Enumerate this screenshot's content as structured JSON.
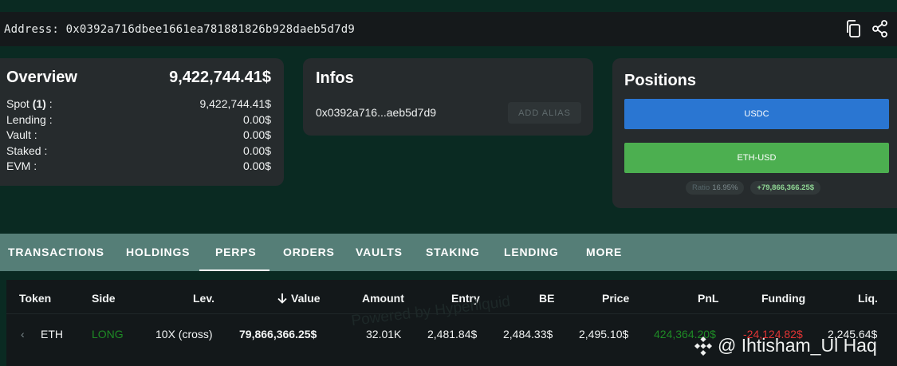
{
  "address_bar": {
    "text": "Address: 0x0392a716dbee1661ea781881826b928daeb5d7d9"
  },
  "overview": {
    "title": "Overview",
    "total": "9,422,744.41$",
    "rows": [
      {
        "label": "Spot",
        "count": "(1)",
        "suffix": " :",
        "value": "9,422,744.41$"
      },
      {
        "label": "Lending :",
        "value": "0.00$"
      },
      {
        "label": "Vault :",
        "value": "0.00$"
      },
      {
        "label": "Staked :",
        "value": "0.00$"
      },
      {
        "label": "EVM :",
        "value": "0.00$"
      }
    ]
  },
  "infos": {
    "title": "Infos",
    "short_address": "0x0392a716...aeb5d7d9",
    "alias_button": "ADD ALIAS"
  },
  "positions": {
    "title": "Positions",
    "usdc_label": "USDC",
    "eth_label": "ETH-USD",
    "ratio_label": "Ratio",
    "ratio_value": "16.95%",
    "pnl_value": "+79,866,366.25$",
    "colors": {
      "usdc": "#2a76d2",
      "eth": "#4caf50"
    }
  },
  "tabs": [
    {
      "label": "TRANSACTIONS"
    },
    {
      "label": "HOLDINGS"
    },
    {
      "label": "PERPS",
      "active": true
    },
    {
      "label": "ORDERS"
    },
    {
      "label": "VAULTS"
    },
    {
      "label": "STAKING"
    },
    {
      "label": "LENDING"
    },
    {
      "label": "MORE"
    }
  ],
  "table": {
    "headers": {
      "token": "Token",
      "side": "Side",
      "lev": "Lev.",
      "value": "Value",
      "amount": "Amount",
      "entry": "Entry",
      "be": "BE",
      "price": "Price",
      "pnl": "PnL",
      "funding": "Funding",
      "liq": "Liq."
    },
    "sort_icon": "arrow-down-icon",
    "rows": [
      {
        "token": "ETH",
        "side": "LONG",
        "lev": "10X (cross)",
        "value": "79,866,366.25$",
        "amount": "32.01K",
        "entry": "2,481.84$",
        "be": "2,484.33$",
        "price": "2,495.10$",
        "pnl": "424,364.20$",
        "funding": "-24,124.82$",
        "liq": "2,245.64$"
      }
    ],
    "colors": {
      "long": "#1e8a25",
      "pnl_positive": "#1e8a25",
      "funding_negative": "#e03434"
    }
  },
  "watermark": "Powered by Hyperliquid",
  "credit": "@ Ihtisham_Ul Haq"
}
